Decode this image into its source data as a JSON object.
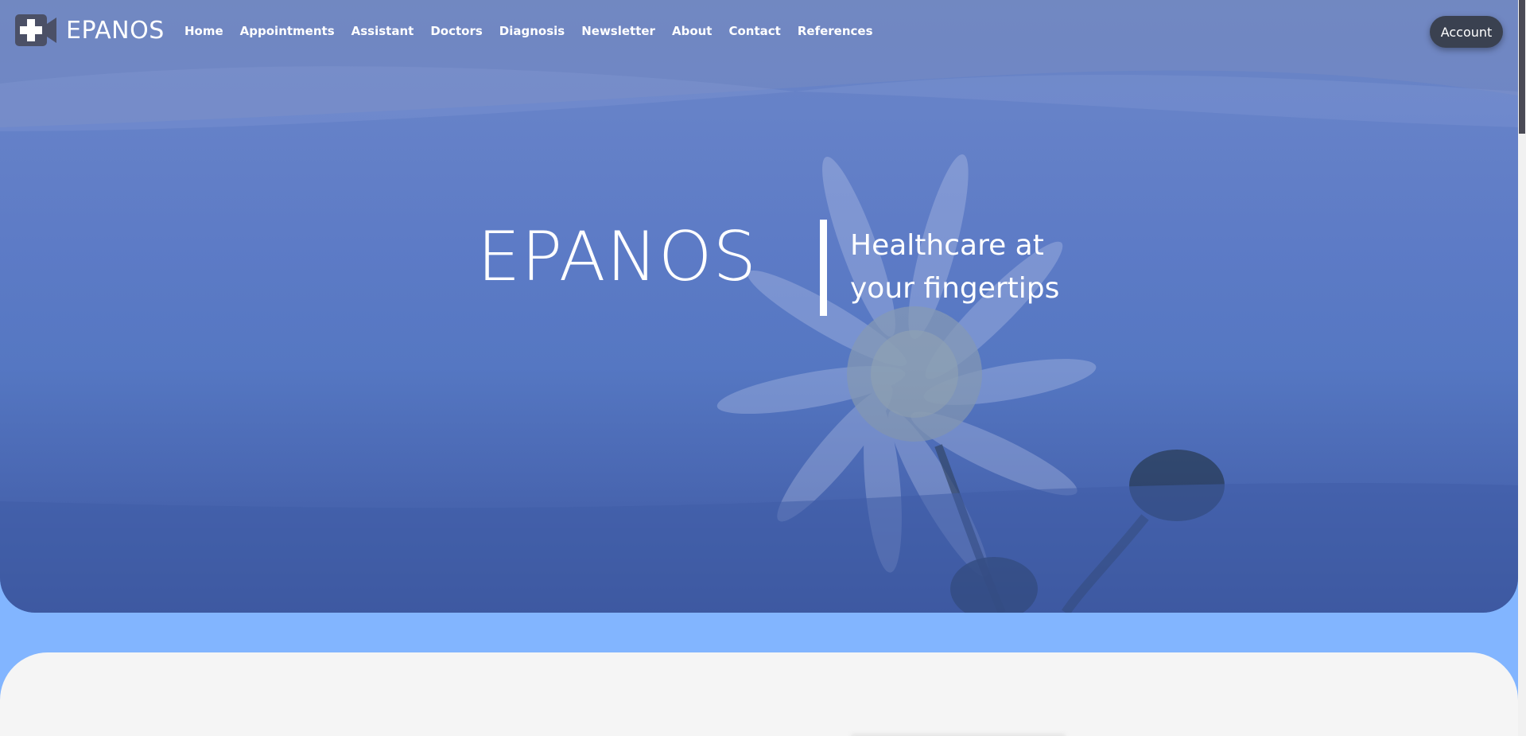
{
  "brand": {
    "name": "EPANOS",
    "icon": "medical-cross-camera-icon"
  },
  "nav": {
    "items": [
      {
        "label": "Home"
      },
      {
        "label": "Appointments"
      },
      {
        "label": "Assistant"
      },
      {
        "label": "Doctors"
      },
      {
        "label": "Diagnosis"
      },
      {
        "label": "Newsletter"
      },
      {
        "label": "About"
      },
      {
        "label": "Contact"
      },
      {
        "label": "References"
      }
    ],
    "account_label": "Account"
  },
  "hero": {
    "title": "EPANOS",
    "tagline_line1": "Healthcare at",
    "tagline_line2": "your fingertips"
  },
  "colors": {
    "page_bg": "#82b5ff",
    "hero_blue": "#5577c2",
    "account_button": "#3a4150",
    "content_bg": "#f5f5f5"
  }
}
